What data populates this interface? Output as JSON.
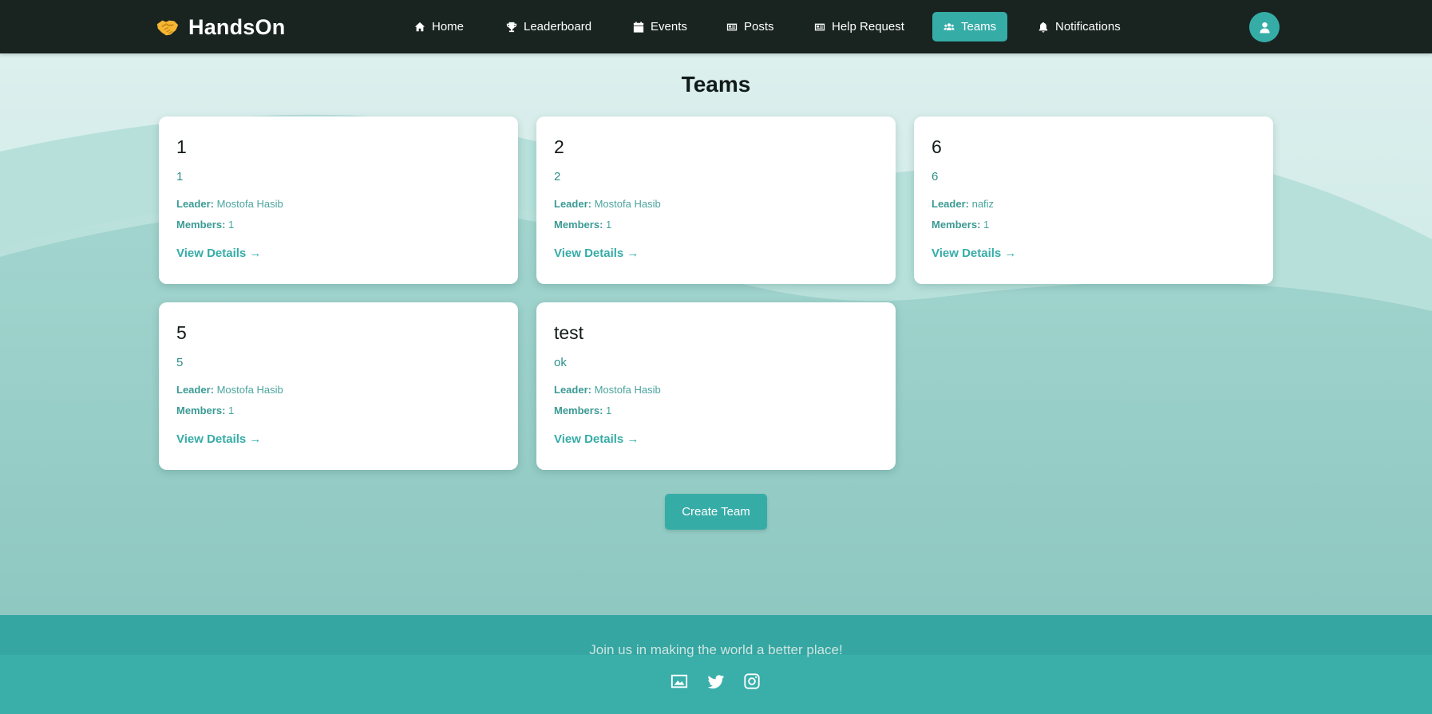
{
  "brand": {
    "name": "HandsOn",
    "icon": "handshake-icon"
  },
  "nav": {
    "items": [
      {
        "label": "Home",
        "icon": "home-icon"
      },
      {
        "label": "Leaderboard",
        "icon": "trophy-icon"
      },
      {
        "label": "Events",
        "icon": "calendar-icon"
      },
      {
        "label": "Posts",
        "icon": "newspaper-icon"
      },
      {
        "label": "Help Request",
        "icon": "newspaper-icon"
      },
      {
        "label": "Teams",
        "icon": "users-icon",
        "active": true
      },
      {
        "label": "Notifications",
        "icon": "bell-icon"
      }
    ],
    "avatar_icon": "user-icon"
  },
  "page": {
    "title": "Teams"
  },
  "teams": [
    {
      "name": "1",
      "description": "1",
      "leader_label": "Leader:",
      "leader": "Mostofa Hasib",
      "members_label": "Members:",
      "members": "1",
      "link": "View Details →"
    },
    {
      "name": "2",
      "description": "2",
      "leader_label": "Leader:",
      "leader": "Mostofa Hasib",
      "members_label": "Members:",
      "members": "1",
      "link": "View Details →"
    },
    {
      "name": "6",
      "description": "6",
      "leader_label": "Leader:",
      "leader": "nafiz",
      "members_label": "Members:",
      "members": "1",
      "link": "View Details →"
    },
    {
      "name": "5",
      "description": "5",
      "leader_label": "Leader:",
      "leader": "Mostofa Hasib",
      "members_label": "Members:",
      "members": "1",
      "link": "View Details →"
    },
    {
      "name": "test",
      "description": "ok",
      "leader_label": "Leader:",
      "leader": "Mostofa Hasib",
      "members_label": "Members:",
      "members": "1",
      "link": "View Details →"
    }
  ],
  "create_button": "Create Team",
  "footer": {
    "tagline": "Join us in making the world a better place!",
    "icons": [
      "image-icon",
      "twitter-icon",
      "instagram-icon"
    ]
  },
  "colors": {
    "nav_bg": "#192421",
    "accent": "#36aca7",
    "footer": "#3aafaa",
    "title": "#121b19"
  }
}
